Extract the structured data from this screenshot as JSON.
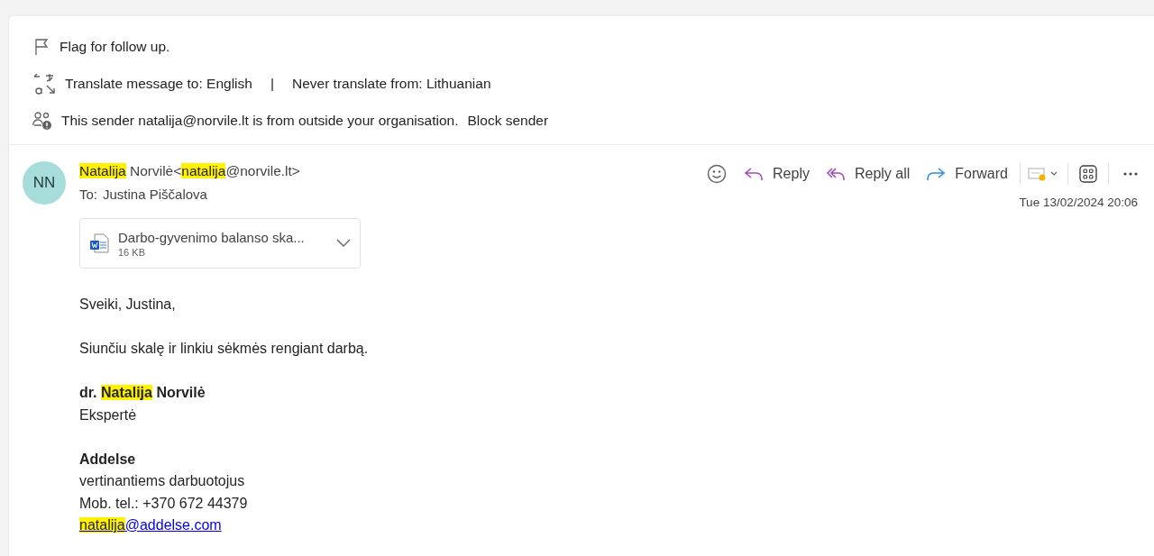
{
  "info_bar": {
    "flag": {
      "text": "Flag for follow up."
    },
    "translate": {
      "to_link": "Translate message to: English",
      "separator": "|",
      "never_link": "Never translate from: Lithuanian"
    },
    "external": {
      "text": "This sender natalija@norvile.lt is from outside your organisation.",
      "block_link": "Block sender"
    }
  },
  "message": {
    "avatar": {
      "initials": "NN",
      "color": "#a6dcd9"
    },
    "sender": [
      {
        "text": "Natalija",
        "highlighted": true
      },
      {
        "text": " Norvilė<",
        "highlighted": false
      },
      {
        "text": "natalija",
        "highlighted": true
      },
      {
        "text": "@norvile.lt>",
        "highlighted": false
      }
    ],
    "to": {
      "label": "To:",
      "name": "Justina Piščalova"
    },
    "actions": [
      {
        "kind": "reply",
        "label": "Reply"
      },
      {
        "kind": "reply_all",
        "label": "Reply all"
      },
      {
        "kind": "forward",
        "label": "Forward"
      }
    ],
    "date": "Tue 13/02/2024 20:06",
    "attachment": {
      "name": "Darbo-gyvenimo balanso ska...",
      "size": "16 KB"
    },
    "body": [
      {
        "lines": [
          {
            "kind": "plain",
            "segments": [
              {
                "text": "Sveiki, Justina,",
                "highlighted": false
              }
            ]
          }
        ]
      },
      {
        "lines": [
          {
            "kind": "plain",
            "segments": [
              {
                "text": "Siunčiu skalę ir linkiu sėkmės rengiant darbą.",
                "highlighted": false
              }
            ]
          }
        ]
      },
      {
        "lines": [
          {
            "kind": "bold",
            "segments": [
              {
                "text": "dr. ",
                "highlighted": false
              },
              {
                "text": "Natalija",
                "highlighted": true
              },
              {
                "text": " Norvilė",
                "highlighted": false
              }
            ]
          },
          {
            "kind": "plain",
            "segments": [
              {
                "text": "Ekspertė",
                "highlighted": false
              }
            ]
          }
        ]
      },
      {
        "lines": [
          {
            "kind": "bold",
            "segments": [
              {
                "text": "Addelse",
                "highlighted": false
              }
            ]
          },
          {
            "kind": "plain",
            "segments": [
              {
                "text": "vertinantiems darbuotojus",
                "highlighted": false
              }
            ]
          },
          {
            "kind": "plain",
            "segments": [
              {
                "text": "Mob. tel.: +370 672 44379",
                "highlighted": false
              }
            ]
          },
          {
            "kind": "link",
            "segments": [
              {
                "text": "natalija",
                "highlighted": true
              },
              {
                "text": "@addelse.com",
                "highlighted": false
              }
            ]
          }
        ]
      }
    ]
  }
}
